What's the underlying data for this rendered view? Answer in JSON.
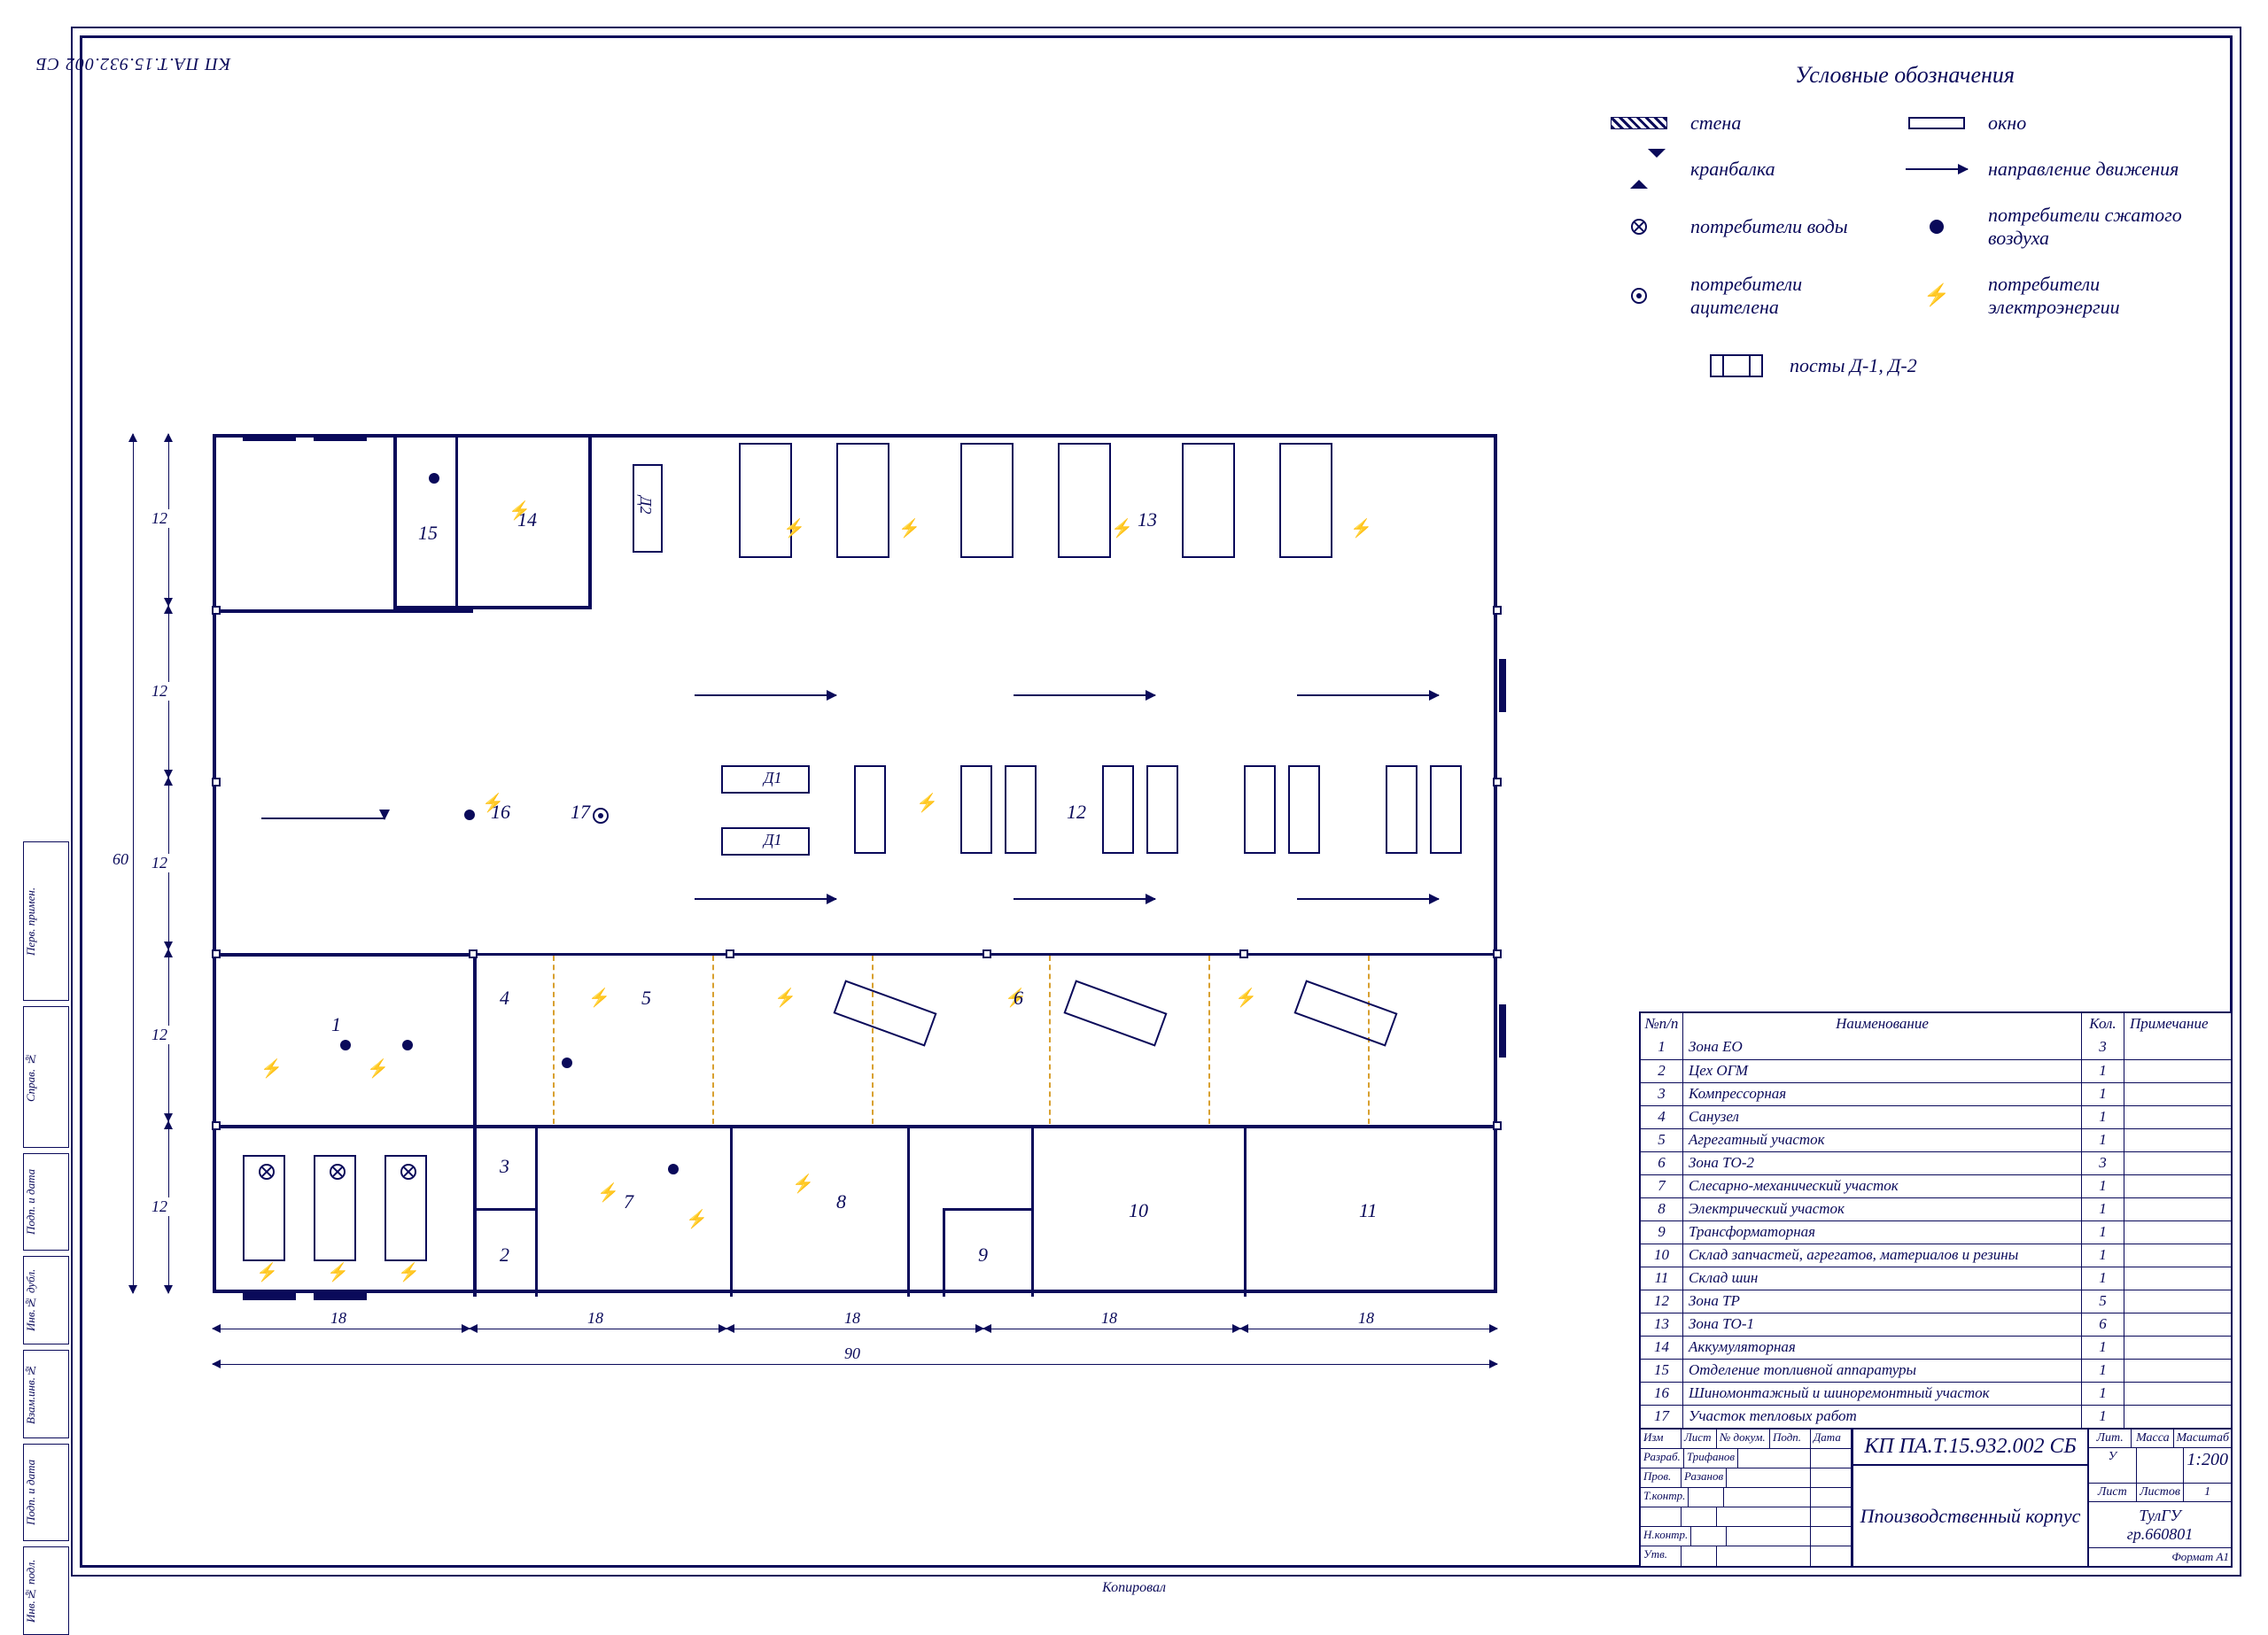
{
  "doc_number_rotated": "КП ПА.Т.15.932.002 СБ",
  "side_tabs": [
    "Перв. примен.",
    "Справ. №",
    "Подп. и дата",
    "Инв.№ дубл.",
    "Взам.инв.№",
    "Подп. и дата",
    "Инв.№ подл."
  ],
  "legend": {
    "title": "Условные обозначения",
    "rows": [
      {
        "s1": "hatch",
        "l1": "стена",
        "s2": "window",
        "l2": "окно"
      },
      {
        "s1": "crane",
        "l1": "кранбалка",
        "s2": "arrow",
        "l2": "направление движения"
      },
      {
        "s1": "circle-x",
        "l1": "потребители воды",
        "s2": "solid-dot",
        "l2": "потребители сжатого воздуха"
      },
      {
        "s1": "circle-dot",
        "l1": "потребители ацителена",
        "s2": "bolt",
        "l2": "потребители электроэнергии"
      },
      {
        "s1": "posty",
        "l1": "посты Д-1, Д-2",
        "s2": "",
        "l2": ""
      }
    ]
  },
  "plan": {
    "overall_w": "90",
    "overall_h": "60",
    "dims_h": [
      "18",
      "18",
      "18",
      "18",
      "18"
    ],
    "dims_v": [
      "12",
      "12",
      "12",
      "12",
      "12"
    ],
    "room_labels": {
      "1": "1",
      "2": "2",
      "3": "3",
      "4": "4",
      "5": "5",
      "6": "6",
      "7": "7",
      "8": "8",
      "9": "9",
      "10": "10",
      "11": "11",
      "12": "12",
      "13": "13",
      "14": "14",
      "15": "15",
      "16": "16",
      "17": "17",
      "d1a": "Д1",
      "d1b": "Д1",
      "d2": "Д2"
    }
  },
  "parts_table": {
    "headers": {
      "n": "№п/п",
      "name": "Наименование",
      "qty": "Кол.",
      "note": "Примечание"
    },
    "rows": [
      {
        "n": "1",
        "name": "Зона ЕО",
        "qty": "3",
        "note": ""
      },
      {
        "n": "2",
        "name": "Цех ОГМ",
        "qty": "1",
        "note": ""
      },
      {
        "n": "3",
        "name": "Компрессорная",
        "qty": "1",
        "note": ""
      },
      {
        "n": "4",
        "name": "Санузел",
        "qty": "1",
        "note": ""
      },
      {
        "n": "5",
        "name": "Агрегатный участок",
        "qty": "1",
        "note": ""
      },
      {
        "n": "6",
        "name": "Зона ТО-2",
        "qty": "3",
        "note": ""
      },
      {
        "n": "7",
        "name": "Слесарно-механический участок",
        "qty": "1",
        "note": ""
      },
      {
        "n": "8",
        "name": "Электрический участок",
        "qty": "1",
        "note": ""
      },
      {
        "n": "9",
        "name": "Трансформаторная",
        "qty": "1",
        "note": ""
      },
      {
        "n": "10",
        "name": "Склад запчастей, агрегатов, материалов и резины",
        "qty": "1",
        "note": ""
      },
      {
        "n": "11",
        "name": "Склад шин",
        "qty": "1",
        "note": ""
      },
      {
        "n": "12",
        "name": "Зона ТР",
        "qty": "5",
        "note": ""
      },
      {
        "n": "13",
        "name": "Зона ТО-1",
        "qty": "6",
        "note": ""
      },
      {
        "n": "14",
        "name": "Аккумуляторная",
        "qty": "1",
        "note": ""
      },
      {
        "n": "15",
        "name": "Отделение топливной аппаратуры",
        "qty": "1",
        "note": ""
      },
      {
        "n": "16",
        "name": "Шиномонтажный и шиноремонтный участок",
        "qty": "1",
        "note": ""
      },
      {
        "n": "17",
        "name": "Участок тепловых работ",
        "qty": "1",
        "note": ""
      }
    ]
  },
  "title_block": {
    "doc_no": "КП ПА.Т.15.932.002 СБ",
    "title": "Ппоизводственный корпус",
    "left_rows": [
      [
        "Изм",
        "Лист",
        "№ докум.",
        "Подп.",
        "Дата"
      ],
      [
        "Разраб.",
        "Трифанов",
        "",
        ""
      ],
      [
        "Пров.",
        "Разанов",
        "",
        ""
      ],
      [
        "Т.контр.",
        "",
        "",
        ""
      ],
      [
        "",
        "",
        "",
        ""
      ],
      [
        "Н.контр.",
        "",
        "",
        ""
      ],
      [
        "Утв.",
        "",
        "",
        ""
      ]
    ],
    "right": {
      "hdr": [
        "Лит.",
        "Масса",
        "Масштаб"
      ],
      "lit": "У",
      "mass": "",
      "scale": "1:200",
      "sheet_lbl": "Лист",
      "sheets_lbl": "Листов",
      "sheets": "1",
      "org": "ТулГУ\nгр.660801",
      "format": "Формат   А1"
    }
  },
  "bottom_label": "Копировал"
}
